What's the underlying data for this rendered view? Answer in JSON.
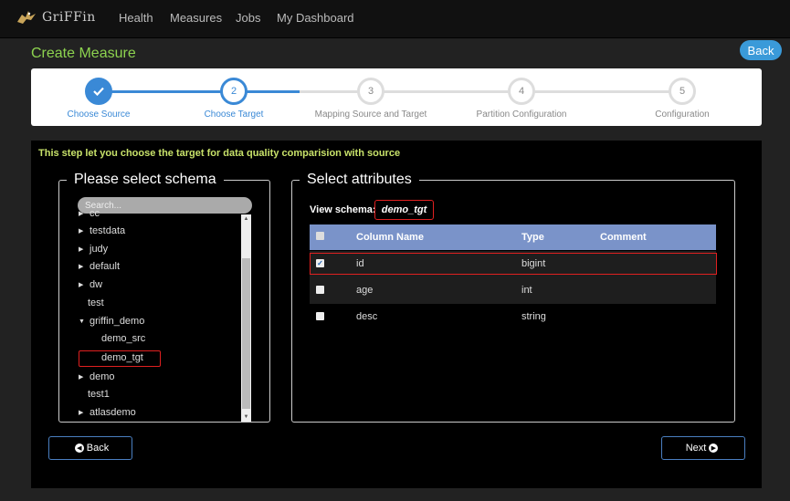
{
  "app": {
    "brand": "GriFFin"
  },
  "nav": {
    "items": [
      "Health",
      "Measures",
      "Jobs",
      "My Dashboard"
    ]
  },
  "page": {
    "title": "Create Measure",
    "back_label": "Back"
  },
  "stepper": {
    "steps": [
      {
        "number": "",
        "label": "Choose Source",
        "state": "done"
      },
      {
        "number": "2",
        "label": "Choose Target",
        "state": "active"
      },
      {
        "number": "3",
        "label": "Mapping Source and Target",
        "state": "todo"
      },
      {
        "number": "4",
        "label": "Partition Configuration",
        "state": "todo"
      },
      {
        "number": "5",
        "label": "Configuration",
        "state": "todo"
      }
    ],
    "colors": {
      "active": "#3a89d6",
      "inactive": "#dddddd"
    }
  },
  "info": {
    "text": "This step let you choose the target for data quality comparision with source"
  },
  "schema_panel": {
    "title": "Please select schema",
    "search_placeholder": "Search...",
    "tree": [
      {
        "label": "cc",
        "expandable": true
      },
      {
        "label": "testdata",
        "expandable": true
      },
      {
        "label": "judy",
        "expandable": true
      },
      {
        "label": "default",
        "expandable": true
      },
      {
        "label": "dw",
        "expandable": true
      },
      {
        "label": "test",
        "expandable": false
      },
      {
        "label": "griffin_demo",
        "expandable": true,
        "expanded": true
      },
      {
        "label": "demo_src",
        "child": true
      },
      {
        "label": "demo_tgt",
        "child": true,
        "selected": true
      },
      {
        "label": "demo",
        "expandable": true
      },
      {
        "label": "test1",
        "expandable": false
      },
      {
        "label": "atlasdemo",
        "expandable": true
      }
    ]
  },
  "attributes_panel": {
    "title": "Select attributes",
    "view_schema_label": "View schema:",
    "schema_name": "demo_tgt",
    "columns": [
      "Column Name",
      "Type",
      "Comment"
    ],
    "rows": [
      {
        "name": "id",
        "type": "bigint",
        "comment": "",
        "checked": true
      },
      {
        "name": "age",
        "type": "int",
        "comment": "",
        "checked": false
      },
      {
        "name": "desc",
        "type": "string",
        "comment": "",
        "checked": false
      }
    ]
  },
  "footer": {
    "back_label": "Back",
    "next_label": "Next"
  },
  "colors": {
    "accent_green": "#8dd34f",
    "info_yellow": "#c8e26a",
    "table_header": "#7a93c9",
    "highlight_red": "#e02020"
  }
}
